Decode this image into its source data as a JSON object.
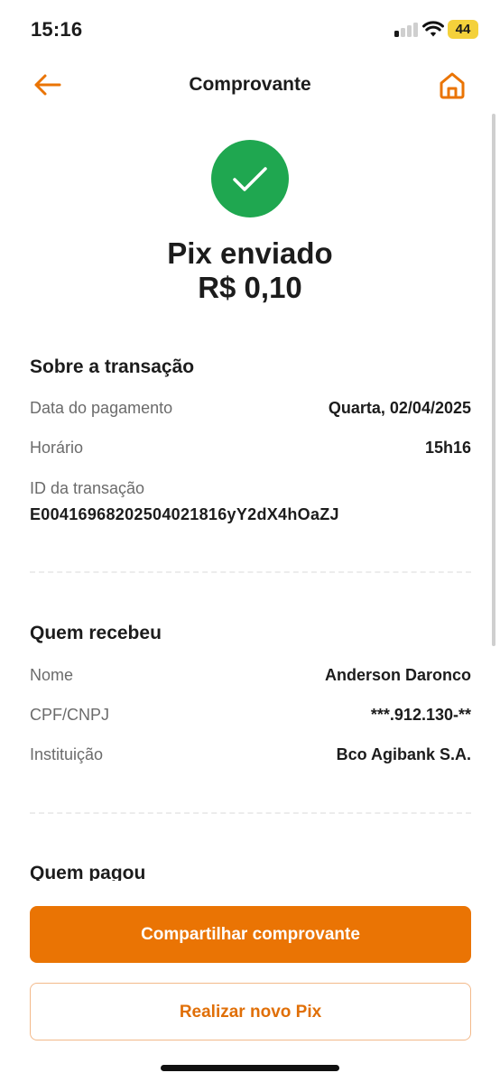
{
  "status_bar": {
    "time": "15:16",
    "battery": "44"
  },
  "header": {
    "title": "Comprovante",
    "back_icon": "arrow-left-icon",
    "home_icon": "home-icon"
  },
  "colors": {
    "accent": "#ea7404",
    "success": "#1fa750",
    "label": "#6b6b6b",
    "text": "#1c1c1c"
  },
  "success": {
    "icon": "checkmark-icon",
    "title": "Pix enviado",
    "amount": "R$ 0,10"
  },
  "transaction": {
    "title": "Sobre a transação",
    "date_label": "Data do pagamento",
    "date_value": "Quarta, 02/04/2025",
    "time_label": "Horário",
    "time_value": "15h16",
    "id_label": "ID da transação",
    "id_value": "E00416968202504021816yY2dX4hOaZJ"
  },
  "receiver": {
    "title": "Quem recebeu",
    "name_label": "Nome",
    "name_value": "Anderson Daronco",
    "doc_label": "CPF/CNPJ",
    "doc_value": "***.912.130-**",
    "institution_label": "Instituição",
    "institution_value": "Bco Agibank S.A."
  },
  "payer": {
    "title": "Quem pagou"
  },
  "actions": {
    "share_label": "Compartilhar comprovante",
    "new_pix_label": "Realizar novo Pix"
  }
}
